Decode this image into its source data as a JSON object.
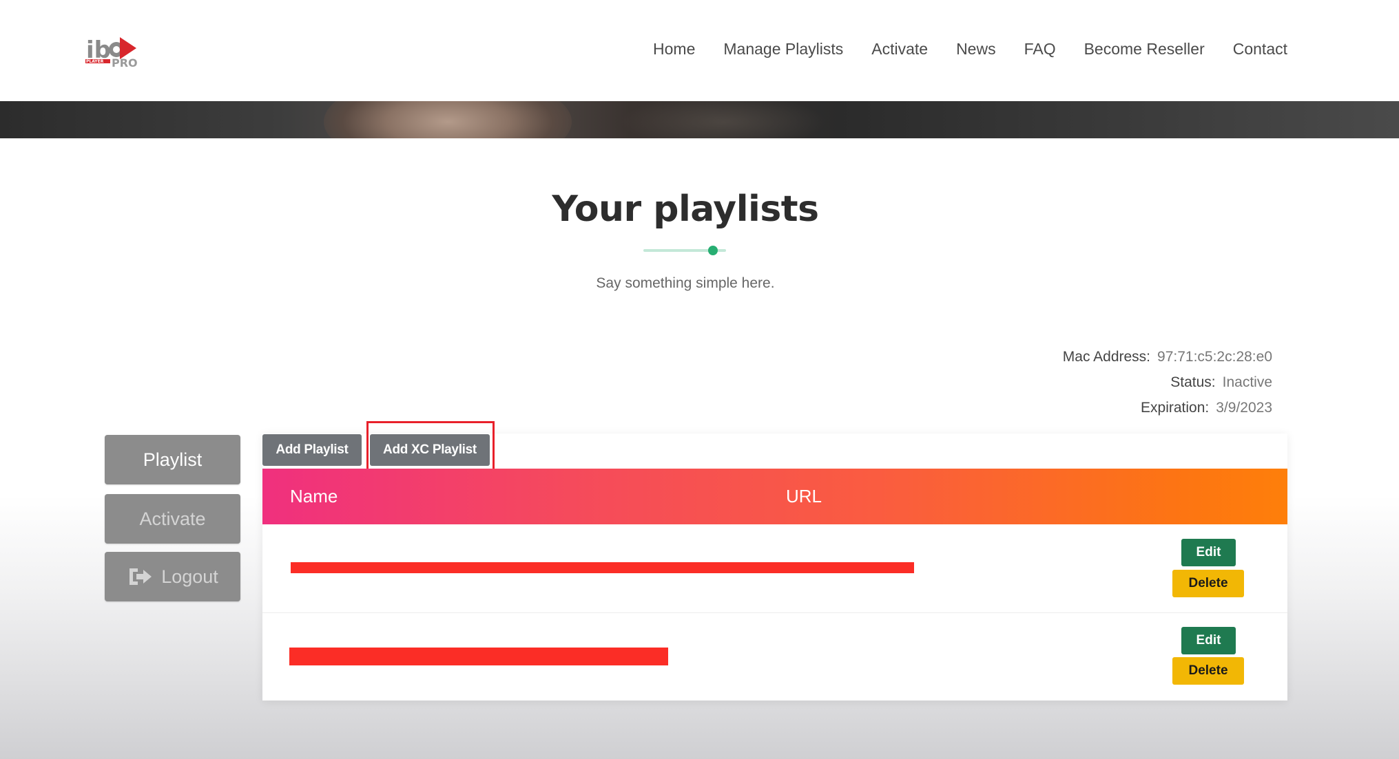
{
  "header": {
    "logo_alt": "ibo PLAYER PRO",
    "nav": [
      {
        "label": "Home"
      },
      {
        "label": "Manage Playlists"
      },
      {
        "label": "Activate"
      },
      {
        "label": "News"
      },
      {
        "label": "FAQ"
      },
      {
        "label": "Become Reseller"
      },
      {
        "label": "Contact"
      }
    ]
  },
  "section": {
    "title": "Your playlists",
    "subtitle": "Say something simple here."
  },
  "device_info": {
    "mac_label": "Mac Address:",
    "mac_value": "97:71:c5:2c:28:e0",
    "status_label": "Status:",
    "status_value": "Inactive",
    "expiration_label": "Expiration:",
    "expiration_value": "3/9/2023"
  },
  "sidebar": {
    "playlist": "Playlist",
    "activate": "Activate",
    "logout": "Logout"
  },
  "tabs": {
    "add_playlist": "Add Playlist",
    "add_xc_playlist": "Add XC Playlist"
  },
  "table": {
    "columns": [
      "Name",
      "URL"
    ],
    "rows": [
      {
        "edit": "Edit",
        "delete": "Delete"
      },
      {
        "edit": "Edit",
        "delete": "Delete"
      }
    ]
  },
  "colors": {
    "header_gradient_start": "#f0307e",
    "header_gradient_end": "#fe7f0a",
    "edit_button": "#1f7a50",
    "delete_button": "#f2b705",
    "sidebar_button": "#8c8c8c",
    "highlight": "#e8202a",
    "redaction": "#fb2d26",
    "accent_dot": "#27ae72"
  },
  "icons": {
    "logout": "sign-out-icon"
  }
}
